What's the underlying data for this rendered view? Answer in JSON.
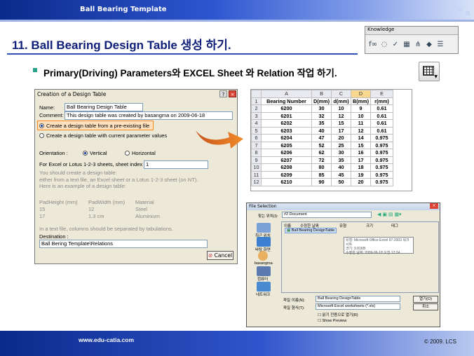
{
  "header": {
    "title": "Ball Bearing Template"
  },
  "slide": {
    "heading": "11. Ball Bearing Design Table 생성 하기.",
    "subheading": "Primary(Driving) Parameters와 EXCEL Sheet 와 Relation 작업 하기."
  },
  "knowledge": {
    "title": "Knowledge",
    "icons": [
      "formula-icon",
      "comment-icon",
      "check-icon",
      "design-table-icon",
      "law-icon",
      "set-icon",
      "list-icon"
    ]
  },
  "dialog": {
    "title": "Creation of a Design Table",
    "name_label": "Name:",
    "name_value": "Ball Bearing Design Table",
    "comment_label": "Comment:",
    "comment_value": "This design table was created by basangma on 2009-06-18",
    "opt1": "Create a design table from a pre-existing file",
    "opt2": "Create a design table with current parameter values",
    "orientation_label": "Orientation :",
    "vertical": "Vertical",
    "horizontal": "Horizontal",
    "sheet_label": "For Excel or Lotus 1-2-3 sheets, sheet index :",
    "sheet_value": "1",
    "info1": "You should create a design table:",
    "info2": "either from a text file, an Excel sheet or a Lotus 1-2-3 sheet (on NT).",
    "info3": "Here is an example of a design table:",
    "ex_h1": "PadHeight (mm)",
    "ex_h2": "PadWidth (mm)",
    "ex_h3": "Material",
    "ex_r1": [
      "15",
      "12",
      "Steel"
    ],
    "ex_r2": [
      "17",
      "1.3 cm",
      "Aluminium"
    ],
    "info4": "In a text file, columns should be separated by tabulations.",
    "dest_label": "Destination :",
    "dest_value": "Ball Bering Template\\Relations",
    "cancel": "Cancel"
  },
  "excel": {
    "cols": [
      "A",
      "B",
      "C",
      "D",
      "E"
    ],
    "headers": [
      "Bearing Number",
      "D(mm)",
      "d(mm)",
      "B(mm)",
      "r(mm)"
    ],
    "rows": [
      [
        "6200",
        "30",
        "10",
        "9",
        "0.61"
      ],
      [
        "6201",
        "32",
        "12",
        "10",
        "0.61"
      ],
      [
        "6202",
        "35",
        "15",
        "11",
        "0.61"
      ],
      [
        "6203",
        "40",
        "17",
        "12",
        "0.61"
      ],
      [
        "6204",
        "47",
        "20",
        "14",
        "0.975"
      ],
      [
        "6205",
        "52",
        "25",
        "15",
        "0.975"
      ],
      [
        "6206",
        "62",
        "30",
        "16",
        "0.975"
      ],
      [
        "6207",
        "72",
        "35",
        "17",
        "0.975"
      ],
      [
        "6208",
        "80",
        "40",
        "18",
        "0.975"
      ],
      [
        "6209",
        "85",
        "45",
        "19",
        "0.975"
      ],
      [
        "6210",
        "90",
        "50",
        "20",
        "0.975"
      ]
    ]
  },
  "file_dialog": {
    "title": "File Selection",
    "lookin_label": "찾는 위치(I):",
    "lookin_value": "#2 Document",
    "col_name": "이름",
    "col_date": "수정한 날짜",
    "col_type": "유형",
    "col_size": "크기",
    "col_tag": "태그",
    "file_item": "Ball Bearing DesignTable",
    "tip1": "유형: Microsoft Office Excel 97-2003 워크시트",
    "tip2": "크기: 9.81KB",
    "tip3": "수정한 날짜: 2009-06-18 오전 12:24",
    "side": [
      "최근 위치",
      "바탕 화면",
      "basangma",
      "컴퓨터",
      "네트워크"
    ],
    "fname_label": "파일 이름(N):",
    "fname_value": "Ball Bearing DesignTable",
    "ftype_label": "파일 형식(T):",
    "ftype_value": "Microsoft Excel worksheets (*.xls)",
    "readonly": "읽기 전용으로 열기(R)",
    "preview": "Show Preview",
    "open": "열기(O)",
    "cancel": "취소"
  },
  "footer": {
    "url": "www.edu-catia.com",
    "copyright": "© 2009. LCS"
  }
}
